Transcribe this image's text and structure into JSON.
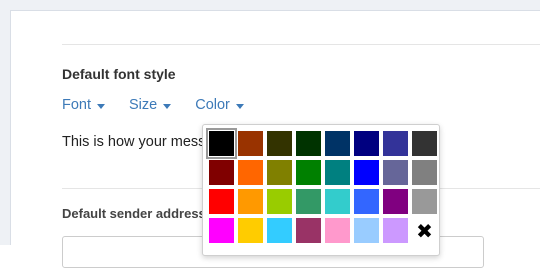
{
  "form": {
    "font_style_title": "Default font style",
    "toolbar": {
      "font_label": "Font",
      "size_label": "Size",
      "color_label": "Color"
    },
    "preview_text": "This is how your message will look",
    "sender_label": "Default sender address"
  },
  "color_picker": {
    "selected": "#000000",
    "clear_icon": "✖",
    "swatches": [
      "#000000",
      "#993300",
      "#333300",
      "#003300",
      "#003366",
      "#000080",
      "#333399",
      "#333333",
      "#800000",
      "#FF6600",
      "#808000",
      "#008000",
      "#008080",
      "#0000FF",
      "#666699",
      "#808080",
      "#FF0000",
      "#FF9900",
      "#99CC00",
      "#339966",
      "#33CCCC",
      "#3366FF",
      "#800080",
      "#999999",
      "#FF00FF",
      "#FFCC00",
      "#33CCFF",
      "#993366",
      "#FF99CC",
      "#99CCFF",
      "#CC99FF",
      "clear"
    ]
  }
}
